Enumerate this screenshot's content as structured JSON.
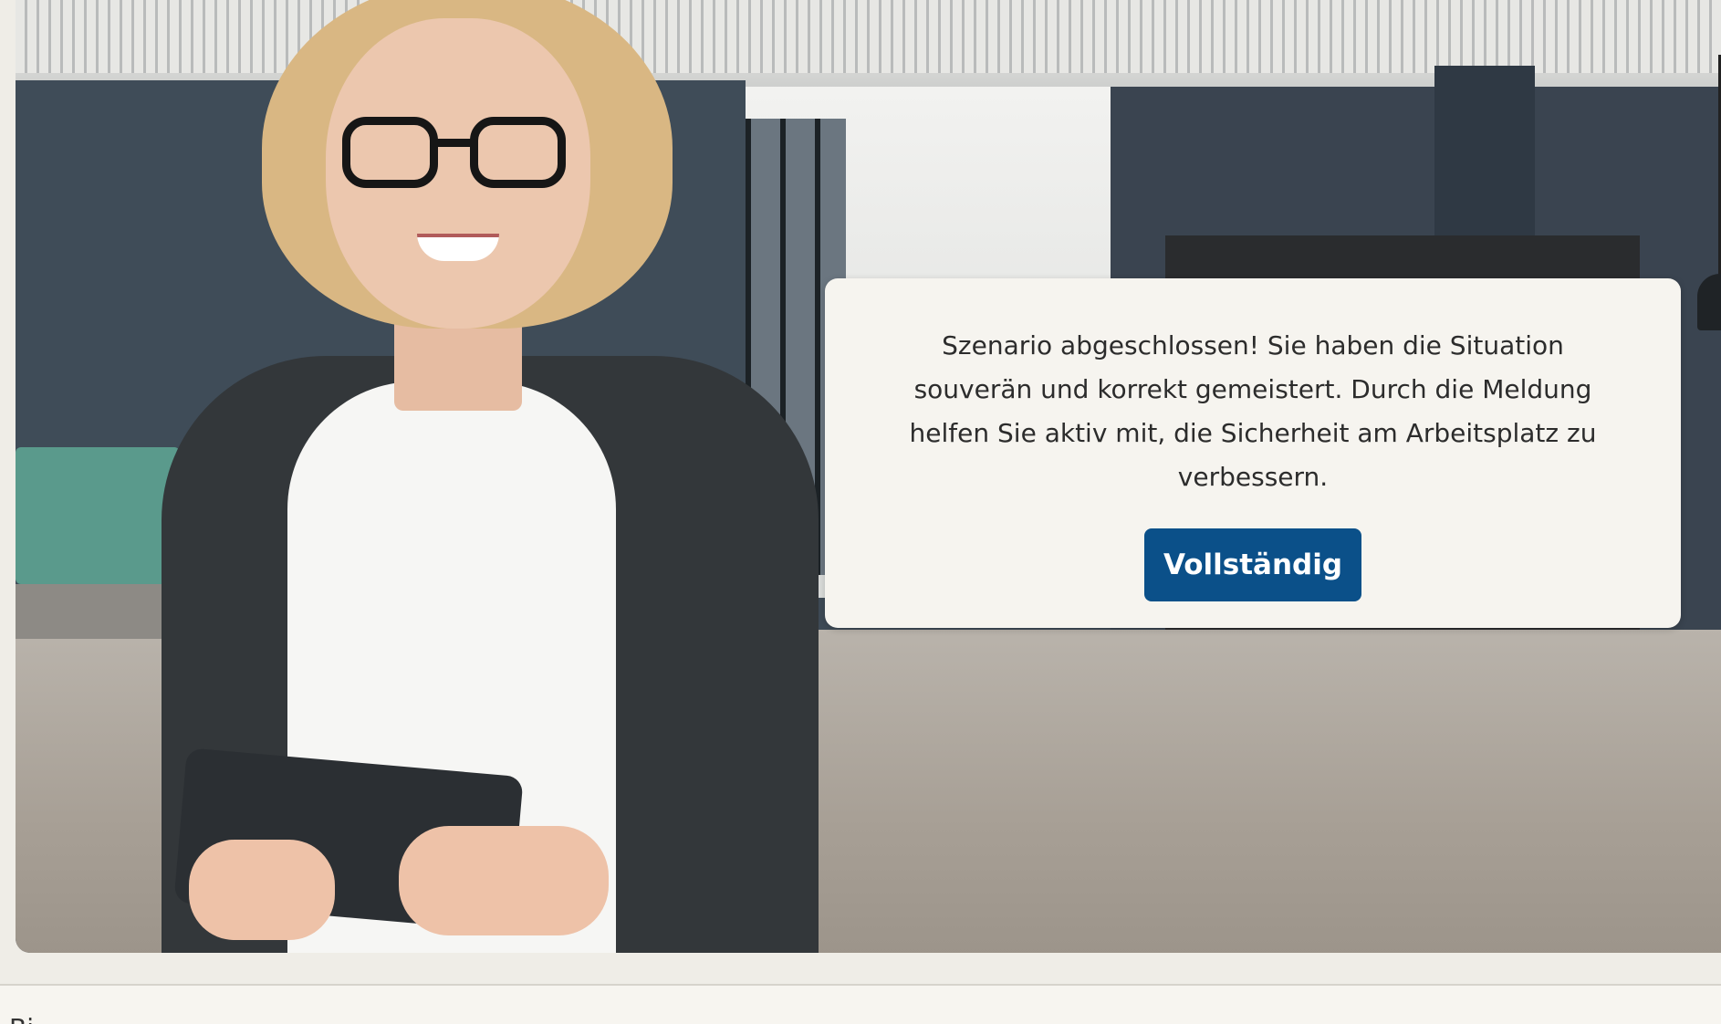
{
  "scenario": {
    "completion_message": "Szenario abgeschlossen! Sie haben die Situation souverän und korrekt gemeistert. Durch die Meldung helfen Sie aktiv mit, die Sicherheit am Arbeitsplatz zu verbessern.",
    "complete_button_label": "Vollständig"
  },
  "colors": {
    "button_background": "#0b5089",
    "dialog_background": "#f6f4ef",
    "page_background": "#efede7"
  },
  "bottom_panel": {
    "label": "Bi"
  }
}
